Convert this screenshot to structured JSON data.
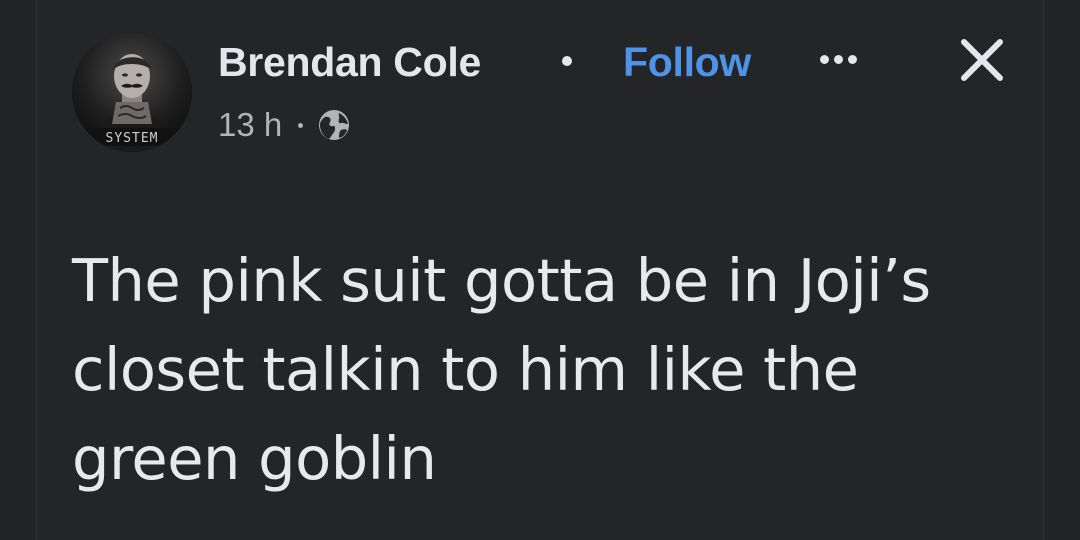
{
  "post": {
    "author": {
      "name": "Brendan Cole",
      "avatar_text": "SYSTEM"
    },
    "follow_label": "Follow",
    "timestamp": "13 h",
    "audience_icon": "globe-icon",
    "more_icon": "more-options-icon",
    "close_icon": "close-icon",
    "text": "The pink suit gotta be in Joji’s closet talkin to him like the green goblin"
  },
  "colors": {
    "background": "#242526",
    "text_primary": "#e4e6eb",
    "text_secondary": "#b0b3b8",
    "link": "#4f93e9"
  }
}
